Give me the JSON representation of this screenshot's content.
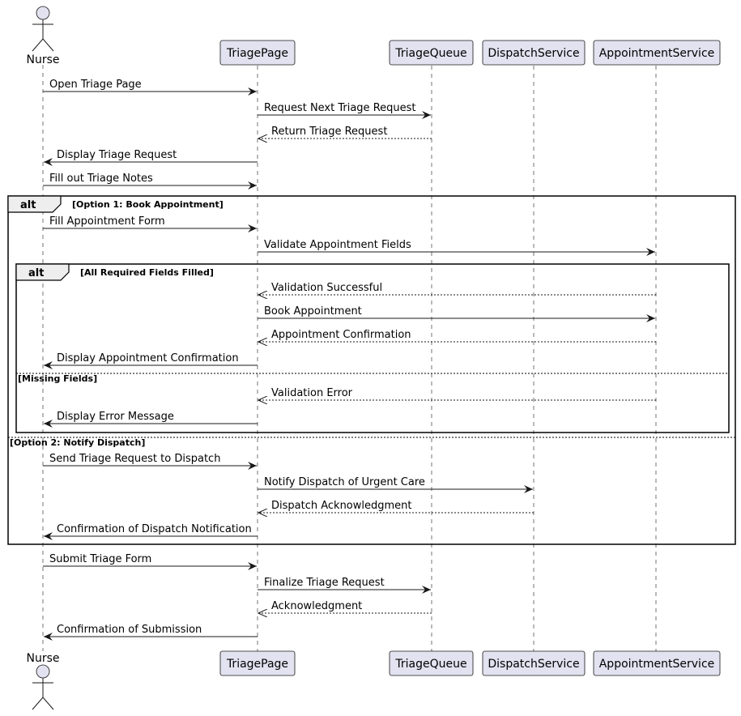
{
  "participants": [
    {
      "name": "Nurse",
      "kind": "actor"
    },
    {
      "name": "TriagePage",
      "kind": "participant"
    },
    {
      "name": "TriageQueue",
      "kind": "participant"
    },
    {
      "name": "DispatchService",
      "kind": "participant"
    },
    {
      "name": "AppointmentService",
      "kind": "participant"
    }
  ],
  "colors": {
    "participant_fill": "#E2E2F0",
    "tab_fill": "#EEEEEE",
    "line": "#181818"
  },
  "messages": [
    {
      "from": 0,
      "to": 1,
      "label": "Open Triage Page",
      "style": "solid"
    },
    {
      "from": 1,
      "to": 2,
      "label": "Request Next Triage Request",
      "style": "solid"
    },
    {
      "from": 2,
      "to": 1,
      "label": "Return Triage Request",
      "style": "dashed"
    },
    {
      "from": 1,
      "to": 0,
      "label": "Display Triage Request",
      "style": "solid"
    },
    {
      "from": 0,
      "to": 1,
      "label": "Fill out Triage Notes",
      "style": "solid"
    },
    {
      "from": 0,
      "to": 1,
      "label": "Fill Appointment Form",
      "style": "solid"
    },
    {
      "from": 1,
      "to": 4,
      "label": "Validate Appointment Fields",
      "style": "solid"
    },
    {
      "from": 4,
      "to": 1,
      "label": "Validation Successful",
      "style": "dashed"
    },
    {
      "from": 1,
      "to": 4,
      "label": "Book Appointment",
      "style": "solid"
    },
    {
      "from": 4,
      "to": 1,
      "label": "Appointment Confirmation",
      "style": "dashed"
    },
    {
      "from": 1,
      "to": 0,
      "label": "Display Appointment Confirmation",
      "style": "solid"
    },
    {
      "from": 4,
      "to": 1,
      "label": "Validation Error",
      "style": "dashed"
    },
    {
      "from": 1,
      "to": 0,
      "label": "Display Error Message",
      "style": "solid"
    },
    {
      "from": 0,
      "to": 1,
      "label": "Send Triage Request to Dispatch",
      "style": "solid"
    },
    {
      "from": 1,
      "to": 3,
      "label": "Notify Dispatch of Urgent Care",
      "style": "solid"
    },
    {
      "from": 3,
      "to": 1,
      "label": "Dispatch Acknowledgment",
      "style": "dashed"
    },
    {
      "from": 1,
      "to": 0,
      "label": "Confirmation of Dispatch Notification",
      "style": "solid"
    },
    {
      "from": 0,
      "to": 1,
      "label": "Submit Triage Form",
      "style": "solid"
    },
    {
      "from": 1,
      "to": 2,
      "label": "Finalize Triage Request",
      "style": "solid"
    },
    {
      "from": 2,
      "to": 1,
      "label": "Acknowledgment",
      "style": "dashed"
    },
    {
      "from": 1,
      "to": 0,
      "label": "Confirmation of Submission",
      "style": "solid"
    }
  ],
  "fragments": [
    {
      "keyword": "alt",
      "guard": "[Option 1: Book Appointment]",
      "else_guards": [
        "[Option 2: Notify Dispatch]"
      ]
    },
    {
      "keyword": "alt",
      "guard": "[All Required Fields Filled]",
      "else_guards": [
        "[Missing Fields]"
      ]
    }
  ]
}
